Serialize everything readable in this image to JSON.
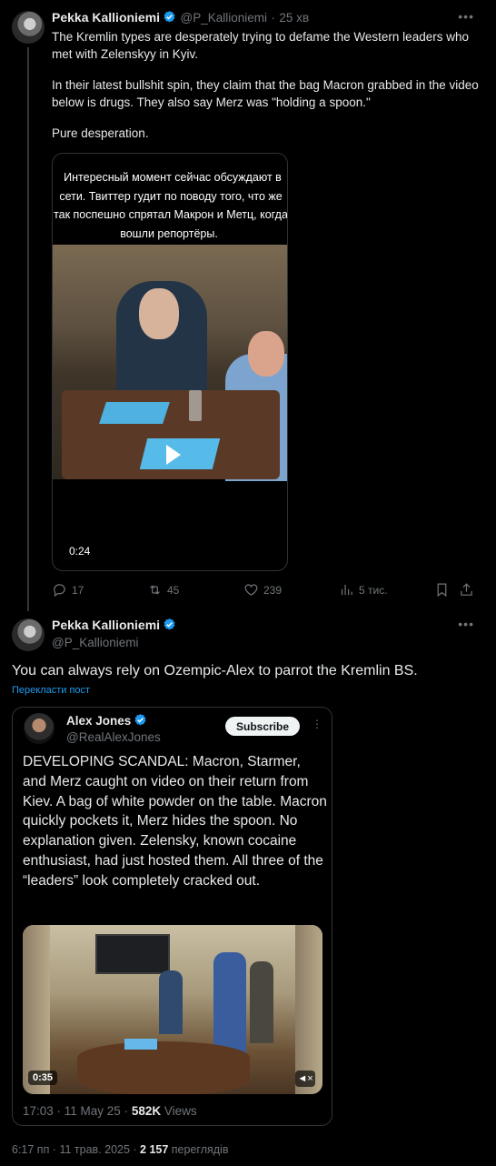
{
  "tweet1": {
    "author_name": "Pekka Kallioniemi",
    "author_handle": "@P_Kallioniemi",
    "separator": "·",
    "time_ago": "25 хв",
    "paragraphs": [
      "The Kremlin types are desperately trying to defame the Western leaders who met with Zelenskyy in Kyiv.",
      "In their latest bullshit spin, they claim that the bag Macron grabbed in the video below is drugs. They also say Merz was \"holding a spoon.\"",
      "Pure desperation."
    ],
    "video": {
      "caption": "Интересный момент сейчас обсуждают в сети. Твиттер гудит по поводу того, что же так поспешно спрятал Макрон и Метц, когда вошли репортёры.",
      "duration": "0:24"
    },
    "actions": {
      "replies": "17",
      "reposts": "45",
      "likes": "239",
      "views": "5 тис."
    }
  },
  "tweet2": {
    "author_name": "Pekka Kallioniemi",
    "author_handle": "@P_Kallioniemi",
    "text": "You can always rely on Ozempic-Alex to parrot the Kremlin BS.",
    "translate_label": "Перекласти пост",
    "quote": {
      "author_name": "Alex Jones",
      "author_handle": "@RealAlexJones",
      "subscribe_label": "Subscribe",
      "text": "DEVELOPING SCANDAL: Macron, Starmer, and Merz caught on video on their return from Kiev. A bag of white powder on the table. Macron quickly pockets it, Merz hides the spoon. No explanation given. Zelensky, known cocaine enthusiast, had just hosted them. All three of the “leaders” look completely cracked out.",
      "video_duration": "0:35",
      "meta_time": "17:03 · 11 May 25 · ",
      "meta_views_count": "582K",
      "meta_views_label": " Views"
    },
    "meta_time": "6:17 пп · 11 трав. 2025 · ",
    "meta_views_count": "2 157",
    "meta_views_label": " переглядів"
  },
  "colors": {
    "background": "#000000",
    "text_primary": "#e7e9ea",
    "text_secondary": "#71767b",
    "accent": "#1d9bf0",
    "border": "#2f3336"
  },
  "icons": [
    "verified-badge-icon",
    "more-options-icon",
    "play-icon",
    "reply-icon",
    "repost-icon",
    "like-icon",
    "views-icon",
    "bookmark-icon",
    "share-icon",
    "mute-icon"
  ]
}
